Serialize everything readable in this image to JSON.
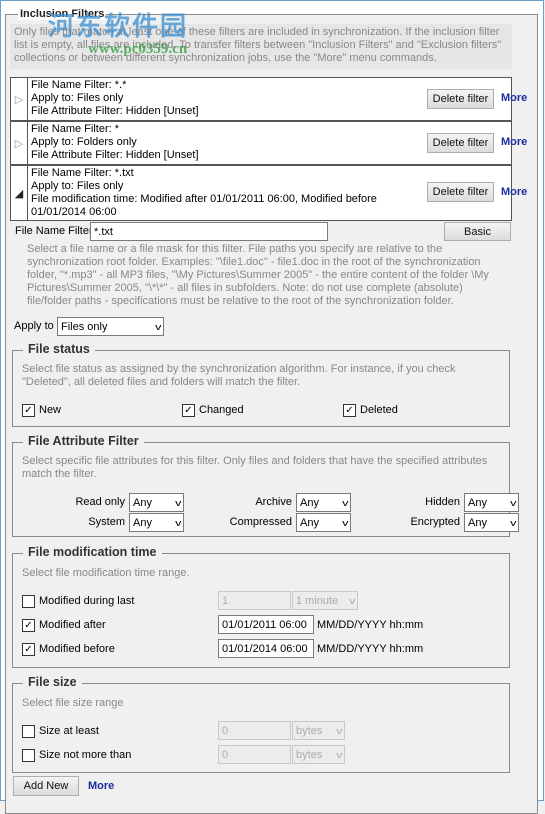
{
  "group_title": "Inclusion Filters",
  "description": "Only files that match at least one of these filters are included in synchronization. If the inclusion filter list is empty, all files are included. To transfer filters between \"Inclusion Filters\" and \"Exclusion filters\" collections or between different synchronization jobs, use the \"More\" menu commands.",
  "filters": [
    {
      "lines": [
        "File Name Filter: *.*",
        "Apply to: Files only",
        "File Attribute Filter: Hidden [Unset]"
      ],
      "expanded": false,
      "delete_label": "Delete filter",
      "more_label": "More"
    },
    {
      "lines": [
        "File Name Filter: *",
        "Apply to: Folders only",
        "File Attribute Filter: Hidden [Unset]"
      ],
      "expanded": false,
      "delete_label": "Delete filter",
      "more_label": "More"
    },
    {
      "lines": [
        "File Name Filter: *.txt",
        "Apply to: Files only",
        "File modification time: Modified after 01/01/2011 06:00, Modified before",
        "01/01/2014 06:00"
      ],
      "expanded": true,
      "delete_label": "Delete filter",
      "more_label": "More"
    }
  ],
  "editor": {
    "name_label": "File Name Filter",
    "name_value": "*.txt",
    "basic_label": "Basic",
    "name_help": "Select a file name or a file mask for this filter. File paths you specify are relative to the synchronization root folder. Examples: \"\\file1.doc\" - file1.doc in the root of the synchronization folder, \"*.mp3\" - all MP3 files, \"\\My Pictures\\Summer 2005\" - the entire content of the folder \\My Pictures\\Summer 2005, \"\\*\\*\" - all files in subfolders. Note: do not use complete (absolute) file/folder paths - specifications must be relative to the root of the synchronization folder.",
    "apply_label": "Apply to",
    "apply_value": "Files only"
  },
  "file_status": {
    "title": "File status",
    "help": "Select file status as assigned by the synchronization algorithm. For instance, if you check \"Deleted\", all deleted files and folders will match the filter.",
    "options": [
      {
        "label": "New",
        "checked": true
      },
      {
        "label": "Changed",
        "checked": true
      },
      {
        "label": "Deleted",
        "checked": true
      }
    ]
  },
  "attributes": {
    "title": "File Attribute Filter",
    "help": "Select specific file attributes for this filter. Only files and folders that have the specified attributes match the filter.",
    "items": [
      {
        "label": "Read only",
        "value": "Any"
      },
      {
        "label": "Archive",
        "value": "Any"
      },
      {
        "label": "Hidden",
        "value": "Any"
      },
      {
        "label": "System",
        "value": "Any"
      },
      {
        "label": "Compressed",
        "value": "Any"
      },
      {
        "label": "Encrypted",
        "value": "Any"
      }
    ]
  },
  "mod_time": {
    "title": "File modification time",
    "help": "Select file modification time range.",
    "during": {
      "label": "Modified during last",
      "checked": false,
      "value": "1",
      "unit": "1 minute"
    },
    "after": {
      "label": "Modified after",
      "checked": true,
      "value": "01/01/2011 06:00",
      "format": "MM/DD/YYYY hh:mm"
    },
    "before": {
      "label": "Modified before",
      "checked": true,
      "value": "01/01/2014 06:00",
      "format": "MM/DD/YYYY hh:mm"
    }
  },
  "file_size": {
    "title": "File size",
    "help": "Select file size range",
    "at_least": {
      "label": "Size at least",
      "checked": false,
      "value": "0",
      "unit": "bytes"
    },
    "not_more": {
      "label": "Size not more than",
      "checked": false,
      "value": "0",
      "unit": "bytes"
    }
  },
  "footer": {
    "add_label": "Add New",
    "more_label": "More"
  },
  "watermark": {
    "text": "河东软件园",
    "url": "www.pc0359.cn"
  }
}
